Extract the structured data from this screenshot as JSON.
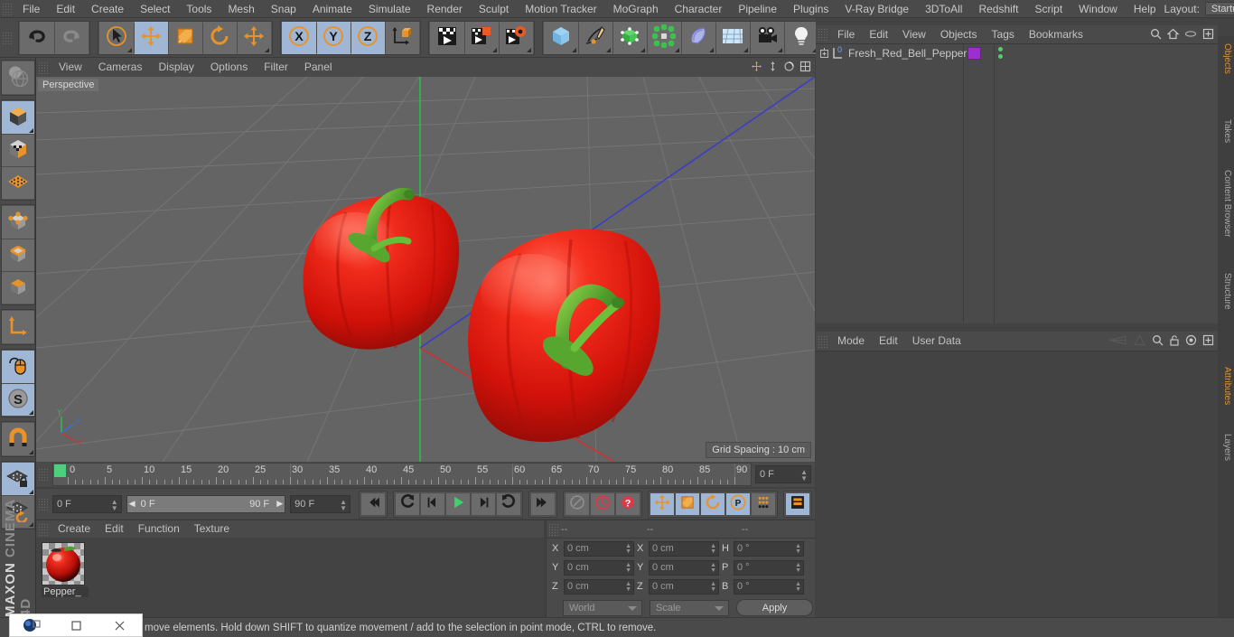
{
  "app": {
    "brand_top": "MAXON",
    "brand_bottom": "CINEMA 4D"
  },
  "menubar": {
    "items": [
      "File",
      "Edit",
      "Create",
      "Select",
      "Tools",
      "Mesh",
      "Snap",
      "Animate",
      "Simulate",
      "Render",
      "Sculpt",
      "Motion Tracker",
      "MoGraph",
      "Character",
      "Pipeline",
      "Plugins",
      "V-Ray Bridge",
      "3DToAll",
      "Redshift",
      "Script",
      "Window",
      "Help"
    ],
    "layout_label": "Layout:",
    "layout_value": "Startup",
    "search_icon": "search-icon"
  },
  "toolbar": {
    "groups": [
      {
        "name": "history",
        "buttons": [
          {
            "icon": "undo-icon",
            "selected": false,
            "corner": false
          },
          {
            "icon": "redo-icon",
            "selected": false,
            "corner": false,
            "disabled": true
          }
        ]
      },
      {
        "name": "tools",
        "buttons": [
          {
            "icon": "live-selection-icon",
            "selected": false,
            "corner": true
          },
          {
            "icon": "move-tool-icon",
            "selected": true,
            "corner": false
          },
          {
            "icon": "scale-tool-icon",
            "selected": false,
            "corner": false
          },
          {
            "icon": "rotate-tool-icon",
            "selected": false,
            "corner": false
          },
          {
            "icon": "move-axis-icon",
            "selected": false,
            "corner": true
          }
        ]
      },
      {
        "name": "axis-locks",
        "buttons": [
          {
            "icon": "x-axis-icon",
            "selected": true,
            "corner": false
          },
          {
            "icon": "y-axis-icon",
            "selected": true,
            "corner": false
          },
          {
            "icon": "z-axis-icon",
            "selected": true,
            "corner": false
          },
          {
            "icon": "world-object-axis-icon",
            "selected": false,
            "corner": false
          }
        ]
      },
      {
        "name": "render",
        "buttons": [
          {
            "icon": "render-view-icon",
            "selected": false,
            "corner": false
          },
          {
            "icon": "render-region-icon",
            "selected": false,
            "corner": true
          },
          {
            "icon": "render-settings-icon",
            "selected": false,
            "corner": true
          }
        ]
      },
      {
        "name": "creation",
        "buttons": [
          {
            "icon": "cube-primitive-icon",
            "selected": false,
            "corner": true
          },
          {
            "icon": "spline-pen-icon",
            "selected": false,
            "corner": true
          },
          {
            "icon": "generator-nurbs-icon",
            "selected": false,
            "corner": true
          },
          {
            "icon": "mograph-cloner-icon",
            "selected": false,
            "corner": true
          },
          {
            "icon": "deformer-bend-icon",
            "selected": false,
            "corner": true
          },
          {
            "icon": "floor-environment-icon",
            "selected": false,
            "corner": true
          },
          {
            "icon": "camera-icon",
            "selected": false,
            "corner": true
          },
          {
            "icon": "light-icon",
            "selected": false,
            "corner": true
          }
        ]
      }
    ]
  },
  "left_toolbar": {
    "groups": [
      {
        "buttons": [
          {
            "icon": "undo-view-globe-icon",
            "selected": false,
            "corner": false
          }
        ]
      },
      {
        "buttons": [
          {
            "icon": "model-mode-icon",
            "selected": true,
            "corner": true
          },
          {
            "icon": "texture-mode-icon",
            "selected": false,
            "corner": false
          },
          {
            "icon": "workplane-mode-icon",
            "selected": false,
            "corner": false
          }
        ]
      },
      {
        "buttons": [
          {
            "icon": "point-mode-icon",
            "selected": false,
            "corner": false
          },
          {
            "icon": "edge-mode-icon",
            "selected": false,
            "corner": false
          },
          {
            "icon": "polygon-mode-icon",
            "selected": false,
            "corner": false
          }
        ]
      },
      {
        "buttons": [
          {
            "icon": "axis-modification-icon",
            "selected": false,
            "corner": false
          }
        ]
      },
      {
        "buttons": [
          {
            "icon": "enable-viewport-mouse-icon",
            "selected": true,
            "corner": false
          },
          {
            "icon": "soft-selection-icon",
            "selected": true,
            "corner": true
          }
        ]
      },
      {
        "buttons": [
          {
            "icon": "snap-magnet-icon",
            "selected": false,
            "corner": true
          }
        ]
      },
      {
        "buttons": [
          {
            "icon": "workplane-lock-icon",
            "selected": true,
            "corner": true
          },
          {
            "icon": "workplane-align-icon",
            "selected": false,
            "corner": true
          }
        ]
      }
    ]
  },
  "viewport": {
    "menu": [
      "View",
      "Cameras",
      "Display",
      "Options",
      "Filter",
      "Panel"
    ],
    "label": "Perspective",
    "grid_spacing": "Grid Spacing : 10 cm",
    "axis_labels": {
      "x": "X",
      "y": "Y",
      "z": "Z"
    },
    "header_icons": [
      "pan-view-icon",
      "zoom-view-icon",
      "rotate-view-icon",
      "maximize-view-icon"
    ]
  },
  "timeline": {
    "ticks": [
      0,
      5,
      10,
      15,
      20,
      25,
      30,
      35,
      40,
      45,
      50,
      55,
      60,
      65,
      70,
      75,
      80,
      85,
      90
    ],
    "range_start": 0,
    "range_end": 90,
    "playhead_frame": "0 F",
    "current_frame_field": "0 F",
    "preview_start": "0 F",
    "preview_end": "90 F",
    "end_frame_field": "90 F"
  },
  "transport": {
    "buttons": [
      {
        "icon": "go-to-start-icon",
        "selected": false
      },
      {
        "icon": "previous-key-icon",
        "selected": false
      },
      {
        "icon": "step-back-icon",
        "selected": false
      },
      {
        "icon": "play-icon",
        "selected": false
      },
      {
        "icon": "step-forward-icon",
        "selected": false
      },
      {
        "icon": "next-key-icon",
        "selected": false
      },
      {
        "icon": "go-to-end-icon",
        "selected": false
      },
      {
        "icon": "record-active-objects-icon",
        "selected": false
      },
      {
        "icon": "autokeying-icon",
        "selected": false
      },
      {
        "icon": "keyframe-selection-icon",
        "selected": false
      },
      {
        "icon": "record-position-icon",
        "selected": true
      },
      {
        "icon": "record-scale-icon",
        "selected": true
      },
      {
        "icon": "record-rotation-icon",
        "selected": true
      },
      {
        "icon": "record-parameter-icon",
        "selected": true
      },
      {
        "icon": "record-pla-icon",
        "selected": false
      },
      {
        "icon": "timeline-toggle-icon",
        "selected": true
      }
    ]
  },
  "material_manager": {
    "menu": [
      "Create",
      "Edit",
      "Function",
      "Texture"
    ],
    "materials": [
      {
        "name": "Pepper_",
        "selected": true,
        "swatch_color": "#d21a12"
      }
    ]
  },
  "coordinates": {
    "headers": [
      "--",
      "--",
      "--"
    ],
    "position": {
      "label_x": "X",
      "label_y": "Y",
      "label_z": "Z",
      "x": "0 cm",
      "y": "0 cm",
      "z": "0 cm"
    },
    "size": {
      "label_x": "X",
      "label_y": "Y",
      "label_z": "Z",
      "x": "0 cm",
      "y": "0 cm",
      "z": "0 cm"
    },
    "rotation": {
      "label_h": "H",
      "label_p": "P",
      "label_b": "B",
      "h": "0 °",
      "p": "0 °",
      "b": "0 °"
    },
    "coord_system": "World",
    "transform_mode": "Scale",
    "apply_label": "Apply"
  },
  "object_manager": {
    "menu": [
      "File",
      "Edit",
      "View",
      "Objects",
      "Tags",
      "Bookmarks"
    ],
    "header_icons": [
      "search-icon",
      "home-icon",
      "ellipse-icon",
      "maximize-icon"
    ],
    "objects": [
      {
        "name": "Fresh_Red_Bell_Pepper",
        "expand_icon": "expand-plus-icon",
        "layer_badge": "0",
        "tag_color": "#9b2fd0",
        "tag_icon": "material-tag-icon",
        "visibility_dots": "#4fcf6a"
      }
    ]
  },
  "attribute_manager": {
    "menu": [
      "Mode",
      "Edit",
      "User Data"
    ],
    "header_icons": [
      "prev-object-icon",
      "next-object-icon",
      "search-icon",
      "lock-icon",
      "target-icon",
      "maximize-icon"
    ],
    "content": ""
  },
  "vertical_tabs": [
    {
      "label": "Objects",
      "active": true
    },
    {
      "label": "Takes",
      "active": false
    },
    {
      "label": "Content Browser",
      "active": false
    },
    {
      "label": "Structure",
      "active": false
    },
    {
      "label": "Attributes",
      "active": true
    },
    {
      "label": "Layers",
      "active": false
    }
  ],
  "status_bar": {
    "message": "move elements. Hold down SHIFT to quantize movement / add to the selection in point mode, CTRL to remove."
  },
  "overlay_window": {
    "app_icon": "cinema4d-logo-icon",
    "buttons": [
      "restore-icon",
      "minimize-icon",
      "close-icon"
    ]
  },
  "colors": {
    "panel": "#4a4a4a",
    "panel_dark": "#434343",
    "viewport_bg": "#646464",
    "selection_blue": "#9fb7d4",
    "accent_orange": "#e09030",
    "pepper_red": "#e01a12",
    "stem_green": "#4f9e2e",
    "playhead_green": "#4bd07e"
  }
}
